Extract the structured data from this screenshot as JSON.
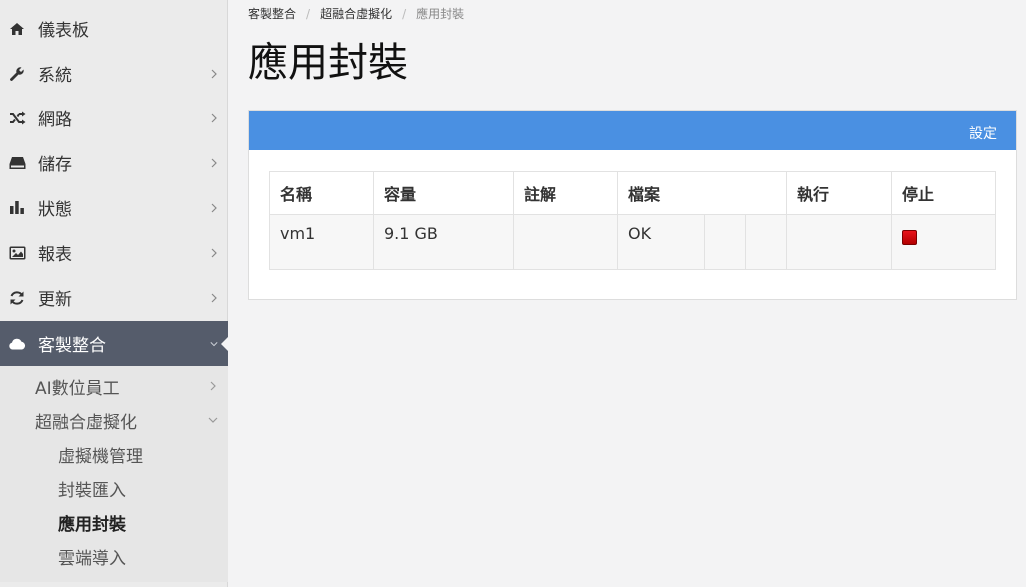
{
  "sidebar": {
    "items": [
      {
        "label": "儀表板",
        "icon": "home-icon"
      },
      {
        "label": "系統",
        "icon": "wrench-icon"
      },
      {
        "label": "網路",
        "icon": "shuffle-icon"
      },
      {
        "label": "儲存",
        "icon": "hard-drive-icon"
      },
      {
        "label": "狀態",
        "icon": "bar-chart-icon"
      },
      {
        "label": "報表",
        "icon": "image-icon"
      },
      {
        "label": "更新",
        "icon": "refresh-icon"
      },
      {
        "label": "客製整合",
        "icon": "cloud-icon"
      }
    ],
    "sub_items": [
      {
        "label": "AI數位員工"
      },
      {
        "label": "超融合虛擬化"
      }
    ],
    "sub2_items": [
      {
        "label": "虛擬機管理"
      },
      {
        "label": "封裝匯入"
      },
      {
        "label": "應用封裝"
      },
      {
        "label": "雲端導入"
      }
    ]
  },
  "breadcrumb": [
    "客製整合",
    "超融合虛擬化",
    "應用封裝"
  ],
  "page_title": "應用封裝",
  "panel": {
    "settings_label": "設定"
  },
  "table": {
    "headers": [
      "名稱",
      "容量",
      "註解",
      "檔案",
      "執行",
      "停止"
    ],
    "rows": [
      {
        "name": "vm1",
        "size": "9.1 GB",
        "note": "",
        "file": "OK"
      }
    ]
  },
  "colors": {
    "accent": "#4a90e2",
    "active_nav": "#555c6b",
    "stop": "#d40000"
  }
}
